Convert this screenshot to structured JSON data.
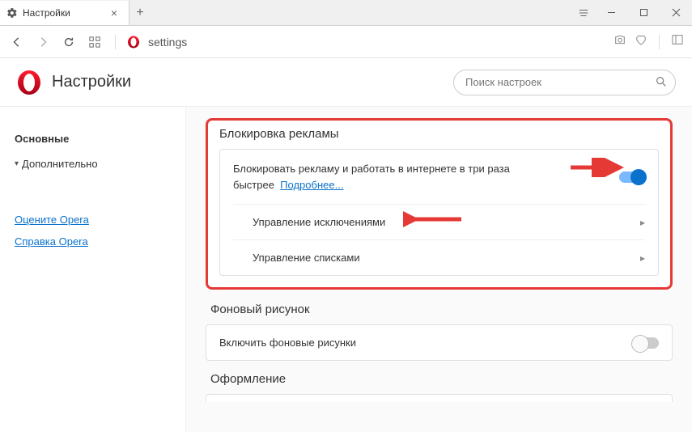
{
  "tab": {
    "title": "Настройки"
  },
  "address": {
    "text": "settings"
  },
  "page": {
    "title": "Настройки",
    "search_placeholder": "Поиск настроек"
  },
  "sidebar": {
    "basic": "Основные",
    "advanced": "Дополнительно",
    "rate": "Оцените Opera",
    "help": "Справка Opera"
  },
  "adblock": {
    "heading": "Блокировка рекламы",
    "desc": "Блокировать рекламу и работать в интернете в три раза быстрее",
    "learn_more": "Подробнее...",
    "exceptions": "Управление исключениями",
    "lists": "Управление списками"
  },
  "wallpaper": {
    "heading": "Фоновый рисунок",
    "row": "Включить фоновые рисунки"
  },
  "appearance": {
    "heading": "Оформление"
  }
}
